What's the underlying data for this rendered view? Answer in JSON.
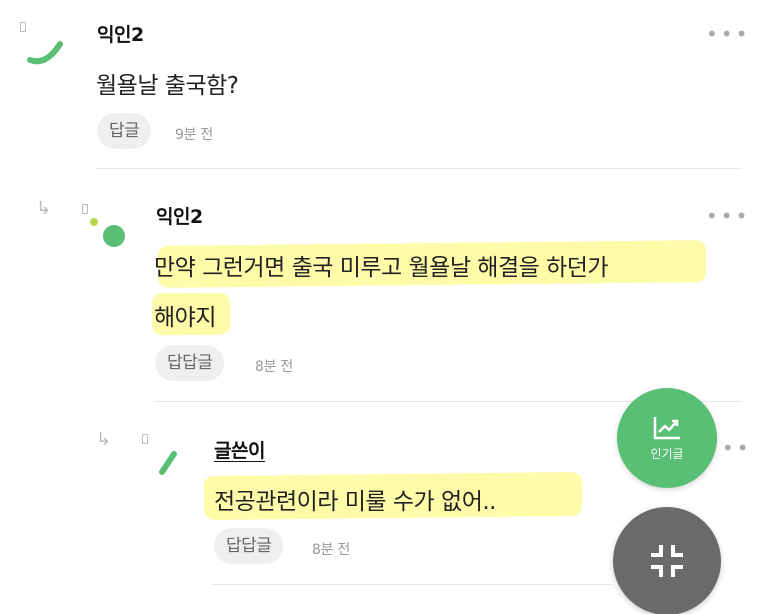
{
  "comments": [
    {
      "author": "익인2",
      "body": "월욜날 출국함?",
      "reply_label": "답글",
      "time": "9분 전",
      "more": "•••"
    },
    {
      "author": "익인2",
      "body_line1": "만약 그런거면 출국 미루고 월욜날 해결을 하던가",
      "body_line2": "해야지",
      "reply_label": "답답글",
      "time": "8분 전",
      "more": "•••"
    },
    {
      "author": "글쓴이",
      "body": "전공관련이라 미룰 수가 없어..",
      "reply_label": "답답글",
      "time": "8분 전",
      "more": "••"
    }
  ],
  "fab": {
    "popular_label": "인기글",
    "popular_icon": "trending-chart-icon",
    "collapse_icon": "collapse-arrows-icon"
  },
  "colors": {
    "accent_green": "#58bf74",
    "highlight": "#fffa8c",
    "fab_gray": "#6a6a6a"
  }
}
